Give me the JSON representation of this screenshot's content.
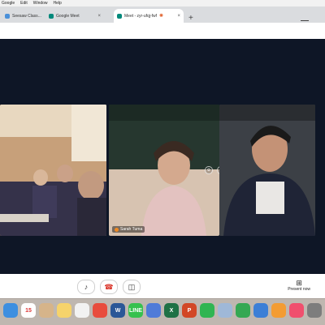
{
  "menubar": {
    "items": [
      "Google",
      "Edit",
      "Window",
      "Help"
    ]
  },
  "tabs": [
    {
      "label": "Seesaw Class...",
      "favicon_color": "#4a90d9",
      "active": false
    },
    {
      "label": "Google Meet",
      "favicon_color": "#00897b",
      "active": false
    },
    {
      "label": "Meet - zyr-ufqj-fwf",
      "favicon_color": "#00897b",
      "active": true
    }
  ],
  "participants": [
    {
      "id": "left",
      "name": ""
    },
    {
      "id": "center",
      "name": "Sarah Tuma"
    },
    {
      "id": "right",
      "name": ""
    }
  ],
  "controls": {
    "mic_icon": "mic-icon",
    "hangup_icon": "hangup-icon",
    "camera_icon": "camera-icon",
    "present_label": "Present now"
  },
  "dock": [
    {
      "name": "finder-icon",
      "color": "#3d8fe0",
      "label": ""
    },
    {
      "name": "calendar-icon",
      "color": "#ffffff",
      "label": "15"
    },
    {
      "name": "contacts-icon",
      "color": "#d6b48a",
      "label": ""
    },
    {
      "name": "notes-icon",
      "color": "#f6d36b",
      "label": ""
    },
    {
      "name": "reminders-icon",
      "color": "#f2f2f2",
      "label": ""
    },
    {
      "name": "chrome-icon",
      "color": "#e84c3d",
      "label": ""
    },
    {
      "name": "word-icon",
      "color": "#2b5797",
      "label": "W"
    },
    {
      "name": "line-icon",
      "color": "#36c14e",
      "label": "LINE"
    },
    {
      "name": "messenger-icon",
      "color": "#4f7bd8",
      "label": ""
    },
    {
      "name": "excel-icon",
      "color": "#1e7145",
      "label": "X"
    },
    {
      "name": "powerpoint-icon",
      "color": "#d24726",
      "label": "P"
    },
    {
      "name": "facetime-icon",
      "color": "#2fb552",
      "label": ""
    },
    {
      "name": "preview-icon",
      "color": "#9fb8d8",
      "label": ""
    },
    {
      "name": "numbers-icon",
      "color": "#35a853",
      "label": ""
    },
    {
      "name": "keynote-icon",
      "color": "#3c7fd6",
      "label": ""
    },
    {
      "name": "books-icon",
      "color": "#f39c33",
      "label": ""
    },
    {
      "name": "music-icon",
      "color": "#f04f6e",
      "label": ""
    },
    {
      "name": "system-preferences-icon",
      "color": "#7d7d7d",
      "label": ""
    }
  ]
}
